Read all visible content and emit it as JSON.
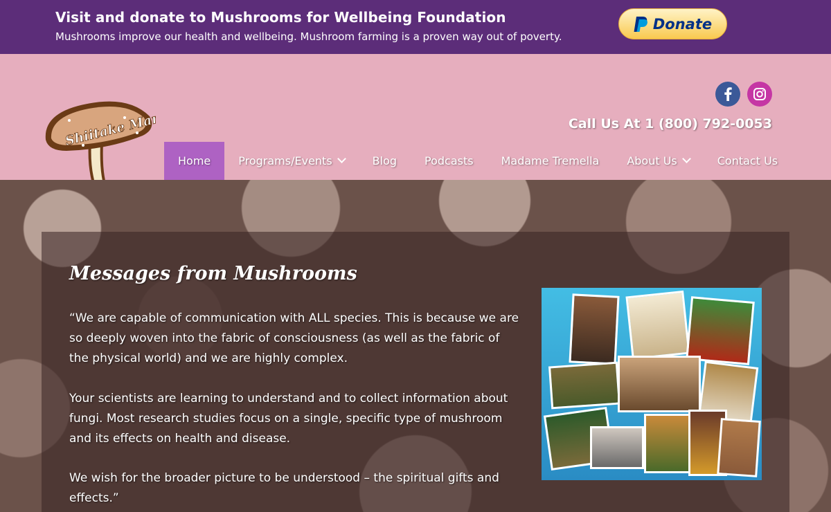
{
  "banner": {
    "title": "Visit and donate to Mushrooms for Wellbeing Foundation",
    "subtitle": "Mushrooms improve our health and wellbeing. Mushroom farming is a proven way out of poverty.",
    "donate_label": "Donate"
  },
  "header": {
    "logo_text": "Shiitake Mama",
    "phone": "Call Us At 1 (800) 792-0053",
    "social": [
      "facebook-icon",
      "instagram-icon"
    ]
  },
  "nav": {
    "items": [
      {
        "label": "Home",
        "active": true
      },
      {
        "label": "Programs/Events",
        "dropdown": true
      },
      {
        "label": "Blog"
      },
      {
        "label": "Podcasts"
      },
      {
        "label": "Madame Tremella"
      },
      {
        "label": "About Us",
        "dropdown": true
      },
      {
        "label": "Contact Us"
      }
    ]
  },
  "main": {
    "heading": "Messages from Mushrooms",
    "paragraphs": [
      "“We are capable of communication with ALL species. This is because we are so deeply woven into the fabric of consciousness (as well as the fabric of the physical world) and we are highly complex.",
      "Your scientists are learning to understand and to collect information about fungi. Most research studies focus on a single, specific type of mushroom and its effects on health and disease.",
      "We wish for the broader picture to be understood – the spiritual gifts and effects.”"
    ]
  },
  "colors": {
    "banner_bg": "#5c2d79",
    "header_bg": "#e6aebe",
    "nav_active": "#ae62c3",
    "facebook": "#3b5998",
    "instagram": "#c536a4"
  }
}
